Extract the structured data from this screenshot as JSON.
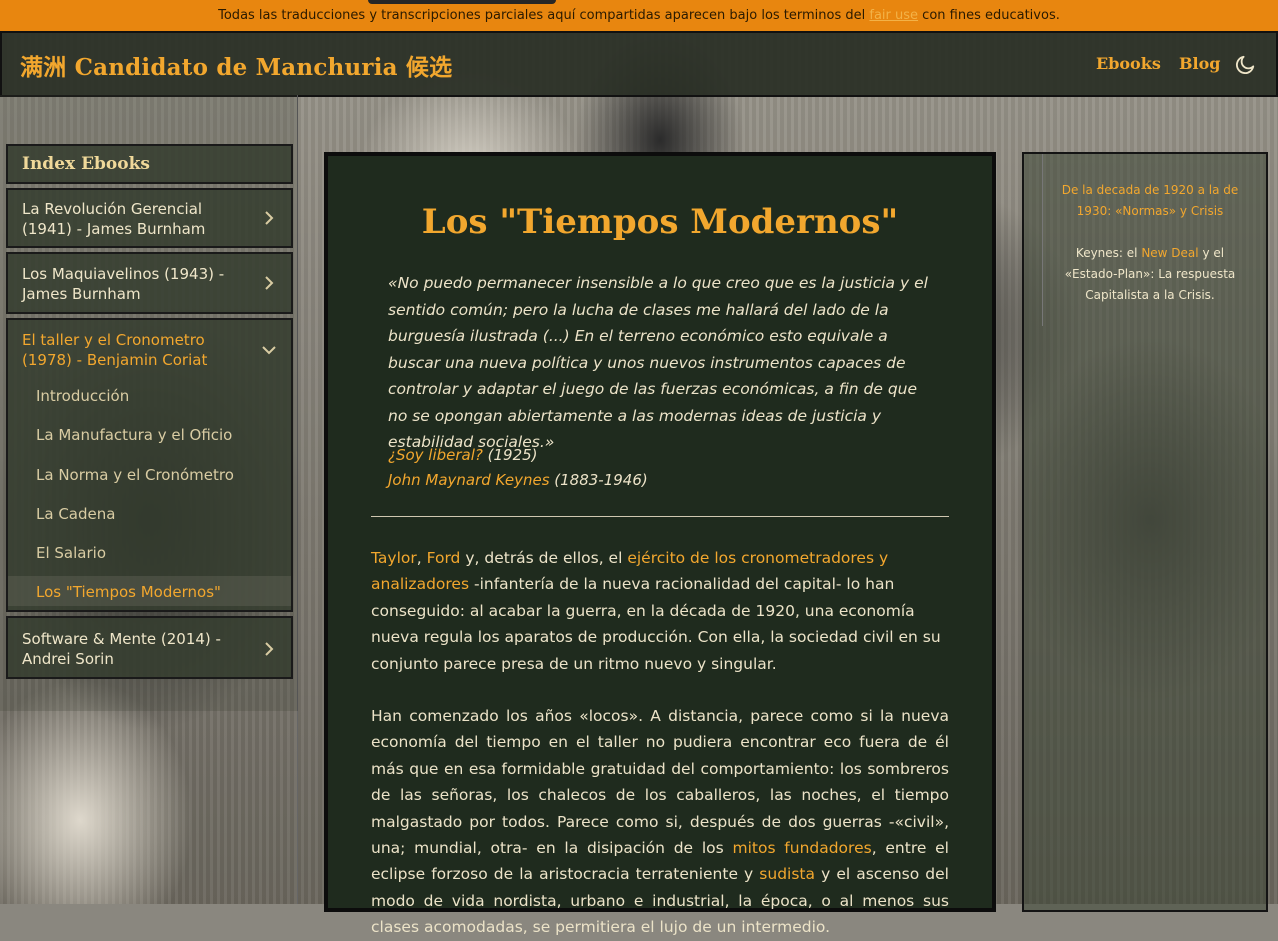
{
  "topbar": {
    "text_before": "Todas las traducciones y transcripciones parciales aquí compartidas aparecen bajo los terminos del ",
    "link": "fair use",
    "text_after": " con fines educativos."
  },
  "navbar": {
    "title": "满洲 Candidato de Manchuria 候选",
    "links": [
      "Ebooks",
      "Blog"
    ],
    "theme_icon": "moon-icon"
  },
  "sidebar": {
    "index_title": "Index Ebooks",
    "ebooks": [
      {
        "label": "La Revolución Gerencial (1941) - James Burnham",
        "icon": "chevron-right-icon"
      },
      {
        "label": "Los Maquiavelinos (1943) - James Burnham",
        "icon": "chevron-right-icon"
      },
      {
        "label": "El taller y el Cronometro (1978) - Benjamin Coriat",
        "icon": "chevron-down-icon",
        "chapters": [
          "Introducción",
          "La Manufactura y el Oficio",
          "La Norma y el Cronómetro",
          "La Cadena",
          "El Salario",
          "Los \"Tiempos Modernos\""
        ]
      },
      {
        "label": "Software & Mente (2014) - Andrei Sorin",
        "icon": "chevron-right-icon"
      }
    ]
  },
  "main": {
    "title": "Los \"Tiempos Modernos\"",
    "quote": "«No puedo permanecer insensible a lo que creo que es la justicia y el sentido común; pero la lucha de clases me hallará del lado de la burguesía ilustrada (...) En el terreno económico esto equivale a buscar una nueva política y unos nuevos instrumentos capaces de controlar y adaptar el juego de las fuerzas económicas, a fin de que no se opongan abiertamente a las modernas ideas de justicia y estabilidad sociales.»",
    "cite_work": "¿Soy liberal?",
    "cite_work_year": " (1925)",
    "cite_author": "John Maynard Keynes",
    "cite_author_years": " (1883-1946)",
    "p1": {
      "link1": "Taylor",
      "sep": ", ",
      "link2": "Ford",
      "mid": " y, detrás de ellos, el ",
      "link3": "ejército de los cronometradores y analizadores",
      "rest": " -infantería de la nueva racionalidad del capital- lo han conseguido: al acabar la guerra, en la década de 1920, una economía nueva regula los aparatos de producción. Con ella, la sociedad civil en su conjunto parece presa de un ritmo nuevo y singular."
    },
    "p2": {
      "a": "Han comenzado los años «locos». A distancia, parece como si la nueva economía del tiempo en el taller no pudiera encontrar eco fuera de él más que en esa formidable gratuidad del comportamiento: los sombreros de las señoras, los chalecos de los caballeros, las noches, el tiempo malgastado por todos. Parece como si, después de dos guerras -«civil», una; mundial, otra- en la disipación de los ",
      "link1": "mitos fundadores",
      "b": ", entre el eclipse forzoso de la aristocracia terrateniente y ",
      "link2": "sudista",
      "c": " y el ascenso del modo de vida nordista, urbano e industrial, la época, o al menos sus clases acomodadas, se permitiera el lujo de un intermedio."
    }
  },
  "toc": {
    "item1": "De la decada de 1920 a la de 1930: «Normas» y Crisis",
    "item2_a": "Keynes: el ",
    "item2_b": "New Deal",
    "item2_c": " y el «Estado-Plan»: La respuesta Capitalista a la Crisis."
  },
  "colors": {
    "accent": "#f2a72e",
    "topbar": "#e8860f",
    "panel": "#1f2b1e"
  }
}
